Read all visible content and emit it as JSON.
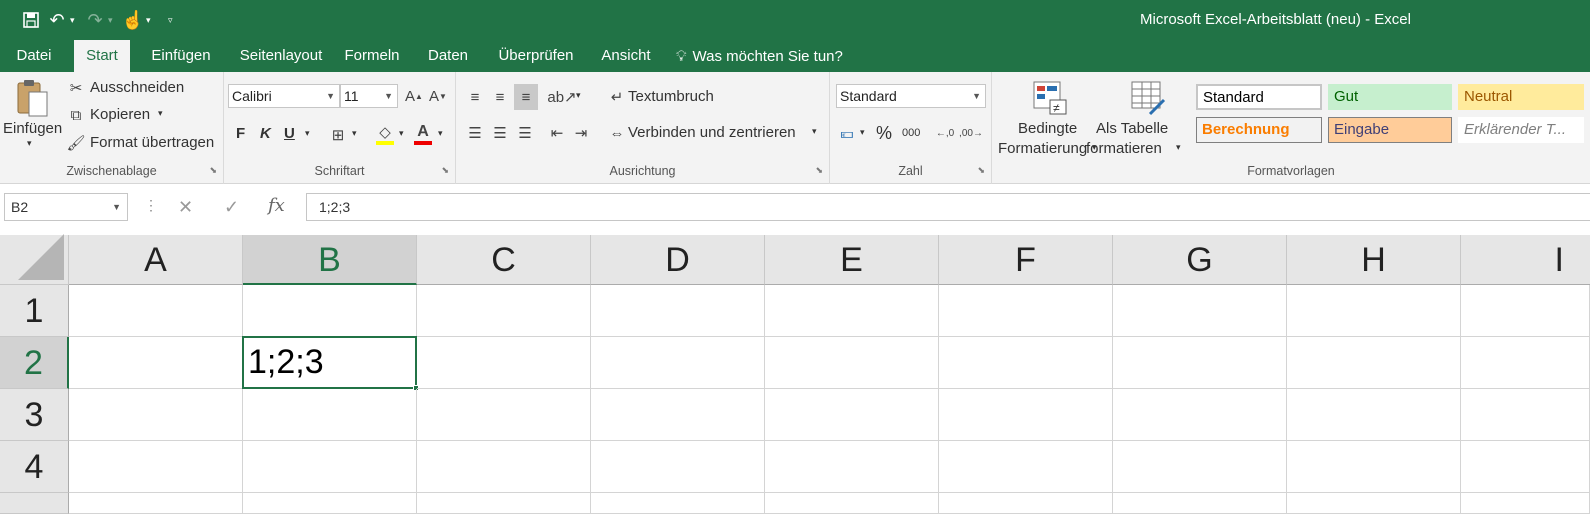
{
  "window": {
    "title": "Microsoft Excel-Arbeitsblatt (neu) - Excel"
  },
  "qat": {
    "save_icon": "save-icon",
    "undo_icon": "undo-icon",
    "redo_icon": "redo-icon",
    "touch_icon": "touch-mode-icon"
  },
  "tabs": [
    {
      "label": "Datei"
    },
    {
      "label": "Start"
    },
    {
      "label": "Einfügen"
    },
    {
      "label": "Seitenlayout"
    },
    {
      "label": "Formeln"
    },
    {
      "label": "Daten"
    },
    {
      "label": "Überprüfen"
    },
    {
      "label": "Ansicht"
    }
  ],
  "tell_me": "Was möchten Sie tun?",
  "ribbon": {
    "clipboard": {
      "label": "Zwischenablage",
      "paste": "Einfügen",
      "cut": "Ausschneiden",
      "copy": "Kopieren",
      "format_painter": "Format übertragen"
    },
    "font": {
      "label": "Schriftart",
      "font_name": "Calibri",
      "font_size": "11",
      "bold": "F",
      "italic": "K",
      "underline": "U"
    },
    "alignment": {
      "label": "Ausrichtung",
      "wrap": "Textumbruch",
      "merge": "Verbinden und zentrieren"
    },
    "number": {
      "label": "Zahl",
      "format": "Standard",
      "percent": "%",
      "thousands": "000"
    },
    "styles": {
      "label": "Formatvorlagen",
      "conditional_1": "Bedingte",
      "conditional_2": "Formatierung",
      "table_1": "Als Tabelle",
      "table_2": "formatieren",
      "standard": "Standard",
      "gut": "Gut",
      "neutral": "Neutral",
      "berechnung": "Berechnung",
      "eingabe": "Eingabe",
      "erklaerend": "Erklärender T..."
    }
  },
  "formula_bar": {
    "name_box": "B2",
    "content": "1;2;3"
  },
  "sheet": {
    "columns": [
      "A",
      "B",
      "C",
      "D",
      "E",
      "F",
      "G",
      "H",
      "I"
    ],
    "rows": [
      "1",
      "2",
      "3",
      "4"
    ],
    "selected_column": "B",
    "selected_row": "2",
    "cells": {
      "B2": "1;2;3"
    }
  },
  "colors": {
    "accent": "#217346",
    "gut_bg": "#c6efce",
    "gut_fg": "#006100",
    "neutral_bg": "#ffeb9c",
    "neutral_fg": "#9c5700",
    "eingabe_bg": "#ffcc99",
    "berechnung_fg": "#fa7d00"
  }
}
